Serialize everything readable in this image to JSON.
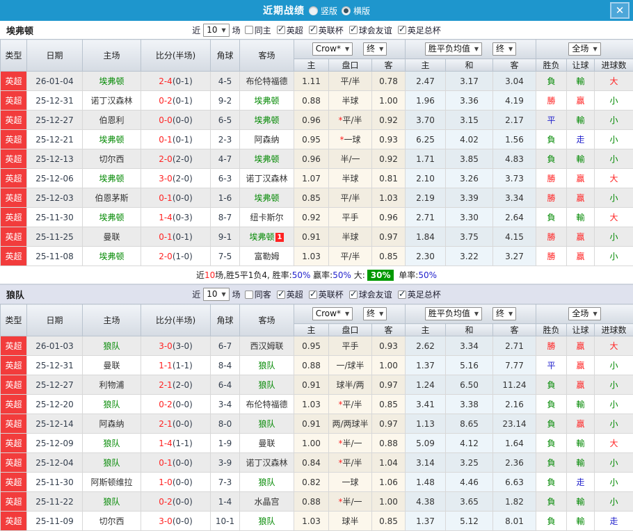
{
  "colors": {
    "titlebar-bg": "#1e96cd",
    "close-bg": "#4da7d9",
    "badge-red": "#f23c3c",
    "text-red": "#ff2222",
    "text-green": "#008800",
    "text-blue": "#2222cc",
    "team-green": "#009900",
    "dark-text": "#333e4d"
  },
  "titlebar": {
    "title": "近期战绩",
    "vertical": "竖版",
    "horizontal": "横版",
    "close": "✕"
  },
  "labels": {
    "near": "近",
    "games": "场"
  },
  "header": {
    "type": "类型",
    "date": "日期",
    "home": "主场",
    "score": "比分(半场)",
    "corner": "角球",
    "away": "客场",
    "odds_source": "Crow*",
    "final": "终",
    "avg": "胜平负均值",
    "scope": "全场",
    "sub_home": "主",
    "sub_pan": "盘口",
    "sub_away": "客",
    "sub_h": "主",
    "sub_d": "和",
    "sub_a": "客",
    "sub_result": "胜负",
    "sub_handicap": "让球",
    "sub_goals": "进球数"
  },
  "teams": [
    {
      "name": "埃弗顿",
      "rounds": "10",
      "same_label": "同主",
      "competitions": [
        "英超",
        "英联杯",
        "球会友谊",
        "英足总杯"
      ],
      "rows": [
        {
          "lg": "英超",
          "dt": "26-01-04",
          "hm": "埃弗顿",
          "hc": "g",
          "sc": "2-4",
          "hf": "(0-1)",
          "cn": "4-5",
          "aw": "布伦特福德",
          "ac": "",
          "bd": "",
          "o1": "1.11",
          "st": "",
          "pk": "平/半",
          "o2": "0.78",
          "m1": "2.47",
          "m2": "3.17",
          "m3": "3.04",
          "r1": "負",
          "r1c": "g",
          "r2": "輸",
          "r2c": "g",
          "r3": "大",
          "r3c": "r"
        },
        {
          "lg": "英超",
          "dt": "25-12-31",
          "hm": "诺丁汉森林",
          "hc": "",
          "sc": "0-2",
          "hf": "(0-1)",
          "cn": "9-2",
          "aw": "埃弗顿",
          "ac": "g",
          "bd": "",
          "o1": "0.88",
          "st": "",
          "pk": "半球",
          "o2": "1.00",
          "m1": "1.96",
          "m2": "3.36",
          "m3": "4.19",
          "r1": "勝",
          "r1c": "r",
          "r2": "贏",
          "r2c": "r",
          "r3": "小",
          "r3c": "g"
        },
        {
          "lg": "英超",
          "dt": "25-12-27",
          "hm": "伯恩利",
          "hc": "",
          "sc": "0-0",
          "hf": "(0-0)",
          "cn": "6-5",
          "aw": "埃弗顿",
          "ac": "g",
          "bd": "",
          "o1": "0.96",
          "st": "*",
          "pk": "平/半",
          "o2": "0.92",
          "m1": "3.70",
          "m2": "3.15",
          "m3": "2.17",
          "r1": "平",
          "r1c": "b",
          "r2": "輸",
          "r2c": "g",
          "r3": "小",
          "r3c": "g"
        },
        {
          "lg": "英超",
          "dt": "25-12-21",
          "hm": "埃弗顿",
          "hc": "g",
          "sc": "0-1",
          "hf": "(0-1)",
          "cn": "2-3",
          "aw": "阿森纳",
          "ac": "",
          "bd": "",
          "o1": "0.95",
          "st": "*",
          "pk": "一球",
          "o2": "0.93",
          "m1": "6.25",
          "m2": "4.02",
          "m3": "1.56",
          "r1": "負",
          "r1c": "g",
          "r2": "走",
          "r2c": "b",
          "r3": "小",
          "r3c": "g"
        },
        {
          "lg": "英超",
          "dt": "25-12-13",
          "hm": "切尔西",
          "hc": "",
          "sc": "2-0",
          "hf": "(2-0)",
          "cn": "4-7",
          "aw": "埃弗顿",
          "ac": "g",
          "bd": "",
          "o1": "0.96",
          "st": "",
          "pk": "半/一",
          "o2": "0.92",
          "m1": "1.71",
          "m2": "3.85",
          "m3": "4.83",
          "r1": "負",
          "r1c": "g",
          "r2": "輸",
          "r2c": "g",
          "r3": "小",
          "r3c": "g"
        },
        {
          "lg": "英超",
          "dt": "25-12-06",
          "hm": "埃弗顿",
          "hc": "g",
          "sc": "3-0",
          "hf": "(2-0)",
          "cn": "6-3",
          "aw": "诺丁汉森林",
          "ac": "",
          "bd": "",
          "o1": "1.07",
          "st": "",
          "pk": "半球",
          "o2": "0.81",
          "m1": "2.10",
          "m2": "3.26",
          "m3": "3.73",
          "r1": "勝",
          "r1c": "r",
          "r2": "贏",
          "r2c": "r",
          "r3": "大",
          "r3c": "r"
        },
        {
          "lg": "英超",
          "dt": "25-12-03",
          "hm": "伯恩茅斯",
          "hc": "",
          "sc": "0-1",
          "hf": "(0-0)",
          "cn": "1-6",
          "aw": "埃弗顿",
          "ac": "g",
          "bd": "",
          "o1": "0.85",
          "st": "",
          "pk": "平/半",
          "o2": "1.03",
          "m1": "2.19",
          "m2": "3.39",
          "m3": "3.34",
          "r1": "勝",
          "r1c": "r",
          "r2": "贏",
          "r2c": "r",
          "r3": "小",
          "r3c": "g"
        },
        {
          "lg": "英超",
          "dt": "25-11-30",
          "hm": "埃弗顿",
          "hc": "g",
          "sc": "1-4",
          "hf": "(0-3)",
          "cn": "8-7",
          "aw": "纽卡斯尔",
          "ac": "",
          "bd": "",
          "o1": "0.92",
          "st": "",
          "pk": "平手",
          "o2": "0.96",
          "m1": "2.71",
          "m2": "3.30",
          "m3": "2.64",
          "r1": "負",
          "r1c": "g",
          "r2": "輸",
          "r2c": "g",
          "r3": "大",
          "r3c": "r"
        },
        {
          "lg": "英超",
          "dt": "25-11-25",
          "hm": "曼联",
          "hc": "",
          "sc": "0-1",
          "hf": "(0-1)",
          "cn": "9-1",
          "aw": "埃弗顿",
          "ac": "g",
          "bd": "1",
          "o1": "0.91",
          "st": "",
          "pk": "半球",
          "o2": "0.97",
          "m1": "1.84",
          "m2": "3.75",
          "m3": "4.15",
          "r1": "勝",
          "r1c": "r",
          "r2": "贏",
          "r2c": "r",
          "r3": "小",
          "r3c": "g"
        },
        {
          "lg": "英超",
          "dt": "25-11-08",
          "hm": "埃弗顿",
          "hc": "g",
          "sc": "2-0",
          "hf": "(1-0)",
          "cn": "7-5",
          "aw": "富勒姆",
          "ac": "",
          "bd": "",
          "o1": "1.03",
          "st": "",
          "pk": "平/半",
          "o2": "0.85",
          "m1": "2.30",
          "m2": "3.22",
          "m3": "3.27",
          "r1": "勝",
          "r1c": "r",
          "r2": "贏",
          "r2c": "r",
          "r3": "小",
          "r3c": "g"
        }
      ],
      "summary": [
        {
          "t": "近",
          "c": ""
        },
        {
          "t": "10",
          "c": "r"
        },
        {
          "t": "场,胜5平1负4, 胜率:",
          "c": ""
        },
        {
          "t": "50%",
          "c": "b"
        },
        {
          "t": " 赢率:",
          "c": ""
        },
        {
          "t": "50%",
          "c": "b"
        },
        {
          "t": " 大:",
          "c": ""
        },
        {
          "t": "30%",
          "c": "gd"
        },
        {
          "t": " 单率:",
          "c": ""
        },
        {
          "t": "50%",
          "c": "b"
        }
      ]
    },
    {
      "name": "狼队",
      "rounds": "10",
      "same_label": "同客",
      "competitions": [
        "英超",
        "英联杯",
        "球会友谊",
        "英足总杯"
      ],
      "rows": [
        {
          "lg": "英超",
          "dt": "26-01-03",
          "hm": "狼队",
          "hc": "g",
          "sc": "3-0",
          "hf": "(3-0)",
          "cn": "6-7",
          "aw": "西汉姆联",
          "ac": "",
          "bd": "",
          "o1": "0.95",
          "st": "",
          "pk": "平手",
          "o2": "0.93",
          "m1": "2.62",
          "m2": "3.34",
          "m3": "2.71",
          "r1": "勝",
          "r1c": "r",
          "r2": "贏",
          "r2c": "r",
          "r3": "大",
          "r3c": "r"
        },
        {
          "lg": "英超",
          "dt": "25-12-31",
          "hm": "曼联",
          "hc": "",
          "sc": "1-1",
          "hf": "(1-1)",
          "cn": "8-4",
          "aw": "狼队",
          "ac": "g",
          "bd": "",
          "o1": "0.88",
          "st": "",
          "pk": "一/球半",
          "o2": "1.00",
          "m1": "1.37",
          "m2": "5.16",
          "m3": "7.77",
          "r1": "平",
          "r1c": "b",
          "r2": "贏",
          "r2c": "r",
          "r3": "小",
          "r3c": "g"
        },
        {
          "lg": "英超",
          "dt": "25-12-27",
          "hm": "利物浦",
          "hc": "",
          "sc": "2-1",
          "hf": "(2-0)",
          "cn": "6-4",
          "aw": "狼队",
          "ac": "g",
          "bd": "",
          "o1": "0.91",
          "st": "",
          "pk": "球半/两",
          "o2": "0.97",
          "m1": "1.24",
          "m2": "6.50",
          "m3": "11.24",
          "r1": "負",
          "r1c": "g",
          "r2": "贏",
          "r2c": "r",
          "r3": "小",
          "r3c": "g"
        },
        {
          "lg": "英超",
          "dt": "25-12-20",
          "hm": "狼队",
          "hc": "g",
          "sc": "0-2",
          "hf": "(0-0)",
          "cn": "3-4",
          "aw": "布伦特福德",
          "ac": "",
          "bd": "",
          "o1": "1.03",
          "st": "*",
          "pk": "平/半",
          "o2": "0.85",
          "m1": "3.41",
          "m2": "3.38",
          "m3": "2.16",
          "r1": "負",
          "r1c": "g",
          "r2": "輸",
          "r2c": "g",
          "r3": "小",
          "r3c": "g"
        },
        {
          "lg": "英超",
          "dt": "25-12-14",
          "hm": "阿森纳",
          "hc": "",
          "sc": "2-1",
          "hf": "(0-0)",
          "cn": "8-0",
          "aw": "狼队",
          "ac": "g",
          "bd": "",
          "o1": "0.91",
          "st": "",
          "pk": "两/两球半",
          "o2": "0.97",
          "m1": "1.13",
          "m2": "8.65",
          "m3": "23.14",
          "r1": "負",
          "r1c": "g",
          "r2": "贏",
          "r2c": "r",
          "r3": "小",
          "r3c": "g"
        },
        {
          "lg": "英超",
          "dt": "25-12-09",
          "hm": "狼队",
          "hc": "g",
          "sc": "1-4",
          "hf": "(1-1)",
          "cn": "1-9",
          "aw": "曼联",
          "ac": "",
          "bd": "",
          "o1": "1.00",
          "st": "*",
          "pk": "半/一",
          "o2": "0.88",
          "m1": "5.09",
          "m2": "4.12",
          "m3": "1.64",
          "r1": "負",
          "r1c": "g",
          "r2": "輸",
          "r2c": "g",
          "r3": "大",
          "r3c": "r"
        },
        {
          "lg": "英超",
          "dt": "25-12-04",
          "hm": "狼队",
          "hc": "g",
          "sc": "0-1",
          "hf": "(0-0)",
          "cn": "3-9",
          "aw": "诺丁汉森林",
          "ac": "",
          "bd": "",
          "o1": "0.84",
          "st": "*",
          "pk": "平/半",
          "o2": "1.04",
          "m1": "3.14",
          "m2": "3.25",
          "m3": "2.36",
          "r1": "負",
          "r1c": "g",
          "r2": "輸",
          "r2c": "g",
          "r3": "小",
          "r3c": "g"
        },
        {
          "lg": "英超",
          "dt": "25-11-30",
          "hm": "阿斯顿维拉",
          "hc": "",
          "sc": "1-0",
          "hf": "(0-0)",
          "cn": "7-3",
          "aw": "狼队",
          "ac": "g",
          "bd": "",
          "o1": "0.82",
          "st": "",
          "pk": "一球",
          "o2": "1.06",
          "m1": "1.48",
          "m2": "4.46",
          "m3": "6.63",
          "r1": "負",
          "r1c": "g",
          "r2": "走",
          "r2c": "b",
          "r3": "小",
          "r3c": "g"
        },
        {
          "lg": "英超",
          "dt": "25-11-22",
          "hm": "狼队",
          "hc": "g",
          "sc": "0-2",
          "hf": "(0-0)",
          "cn": "1-4",
          "aw": "水晶宫",
          "ac": "",
          "bd": "",
          "o1": "0.88",
          "st": "*",
          "pk": "半/一",
          "o2": "1.00",
          "m1": "4.38",
          "m2": "3.65",
          "m3": "1.82",
          "r1": "負",
          "r1c": "g",
          "r2": "輸",
          "r2c": "g",
          "r3": "小",
          "r3c": "g"
        },
        {
          "lg": "英超",
          "dt": "25-11-09",
          "hm": "切尔西",
          "hc": "",
          "sc": "3-0",
          "hf": "(0-0)",
          "cn": "10-1",
          "aw": "狼队",
          "ac": "g",
          "bd": "",
          "o1": "1.03",
          "st": "",
          "pk": "球半",
          "o2": "0.85",
          "m1": "1.37",
          "m2": "5.12",
          "m3": "8.01",
          "r1": "負",
          "r1c": "g",
          "r2": "輸",
          "r2c": "g",
          "r3": "走",
          "r3c": "b"
        }
      ]
    }
  ]
}
